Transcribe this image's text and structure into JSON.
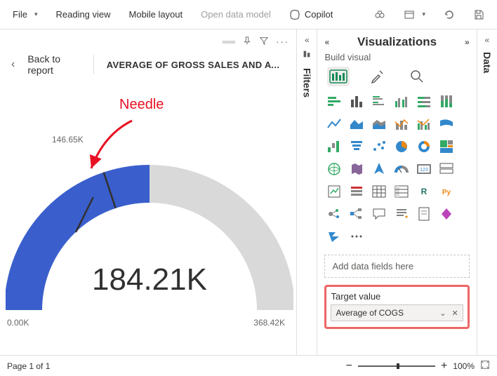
{
  "cmdbar": {
    "file": "File",
    "reading_view": "Reading view",
    "mobile_layout": "Mobile layout",
    "open_data_model": "Open data model",
    "copilot": "Copilot"
  },
  "canvas": {
    "back": "Back to report",
    "title": "AVERAGE OF GROSS SALES AND AVERAG...",
    "annotation": "Needle"
  },
  "rails": {
    "filters": "Filters",
    "data": "Data"
  },
  "vispane": {
    "header": "Visualizations",
    "sub": "Build visual",
    "add_placeholder": "Add data fields here",
    "target_label": "Target value",
    "target_field": "Average of COGS"
  },
  "footer": {
    "page": "Page 1 of 1",
    "zoom": "100%"
  },
  "chart_data": {
    "type": "gauge",
    "value_label": "184.21K",
    "value_numeric": 184210,
    "min": 0,
    "min_label": "0.00K",
    "max": 368420,
    "max_label": "368.42K",
    "target": 146650,
    "target_label": "146.65K",
    "fill_fraction": 0.5,
    "needle_fraction": 0.398,
    "title": "AVERAGE OF GROSS SALES AND AVERAGE OF COGS"
  }
}
